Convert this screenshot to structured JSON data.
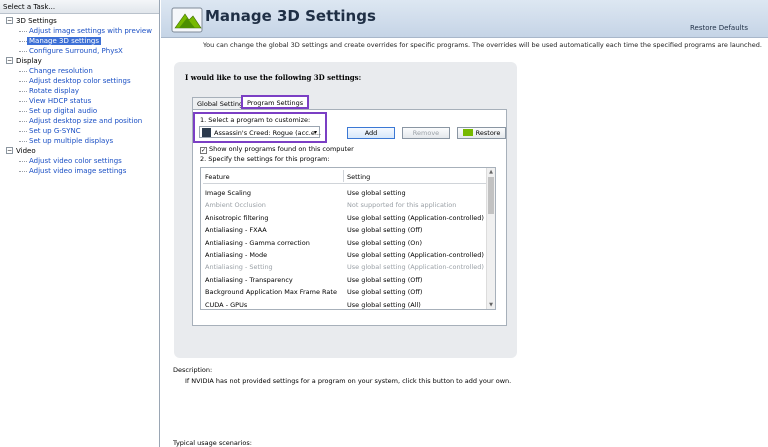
{
  "task_pane": {
    "title": "Select a Task...",
    "categories": [
      {
        "label": "3D Settings",
        "items": [
          "Adjust image settings with preview",
          "Manage 3D settings",
          "Configure Surround, PhysX"
        ]
      },
      {
        "label": "Display",
        "items": [
          "Change resolution",
          "Adjust desktop color settings",
          "Rotate display",
          "View HDCP status",
          "Set up digital audio",
          "Adjust desktop size and position",
          "Set up G-SYNC",
          "Set up multiple displays"
        ]
      },
      {
        "label": "Video",
        "items": [
          "Adjust video color settings",
          "Adjust video image settings"
        ]
      }
    ]
  },
  "header": {
    "title": "Manage 3D Settings",
    "restore_defaults": "Restore Defaults"
  },
  "intro": "You can change the global 3D settings and create overrides for specific programs. The overrides will be used automatically each time the specified programs are launched.",
  "panel": {
    "title": "I would like to use the following 3D settings:",
    "tabs": [
      "Global Settings",
      "Program Settings"
    ],
    "step1": "1. Select a program to customize:",
    "program_selected": "Assassin's Creed: Rogue (acc.e...",
    "add_label": "Add",
    "remove_label": "Remove",
    "restore_label": "Restore",
    "show_only_label": "Show only programs found on this computer",
    "step2": "2. Specify the settings for this program:",
    "table": {
      "headers": [
        "Feature",
        "Setting"
      ],
      "rows": [
        {
          "feature": "Image Scaling",
          "setting": "Use global setting",
          "disabled": false
        },
        {
          "feature": "Ambient Occlusion",
          "setting": "Not supported for this application",
          "disabled": true
        },
        {
          "feature": "Anisotropic filtering",
          "setting": "Use global setting (Application-controlled)",
          "disabled": false
        },
        {
          "feature": "Antialiasing - FXAA",
          "setting": "Use global setting (Off)",
          "disabled": false
        },
        {
          "feature": "Antialiasing - Gamma correction",
          "setting": "Use global setting (On)",
          "disabled": false
        },
        {
          "feature": "Antialiasing - Mode",
          "setting": "Use global setting (Application-controlled)",
          "disabled": false
        },
        {
          "feature": "Antialiasing - Setting",
          "setting": "Use global setting (Application-controlled)",
          "disabled": true
        },
        {
          "feature": "Antialiasing - Transparency",
          "setting": "Use global setting (Off)",
          "disabled": false
        },
        {
          "feature": "Background Application Max Frame Rate",
          "setting": "Use global setting (Off)",
          "disabled": false
        },
        {
          "feature": "CUDA - GPUs",
          "setting": "Use global setting (All)",
          "disabled": false
        }
      ]
    }
  },
  "description": {
    "label": "Description:",
    "text": "If NVIDIA has not provided settings for a program on your system, click this button to add your own."
  },
  "usage_label": "Typical usage scenarios:",
  "colors": {
    "highlight": "#7b3fc4",
    "link": "#1a4fc4",
    "selected": "#3d70d6",
    "nvidia": "#76b900"
  }
}
